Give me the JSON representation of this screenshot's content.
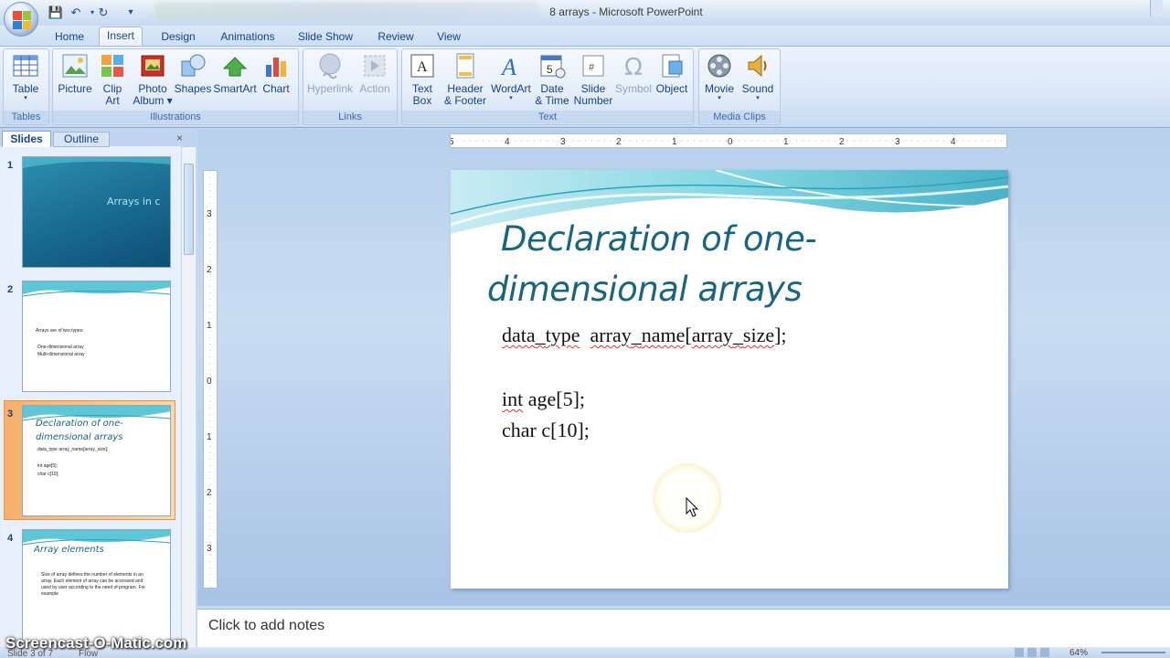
{
  "window": {
    "title": "8 arrays - Microsoft PowerPoint"
  },
  "quick_access": {
    "save_icon": "save-icon",
    "undo_icon": "undo-icon",
    "redo_icon": "redo-icon"
  },
  "tabs": [
    {
      "label": "Home"
    },
    {
      "label": "Insert",
      "active": true
    },
    {
      "label": "Design"
    },
    {
      "label": "Animations"
    },
    {
      "label": "Slide Show"
    },
    {
      "label": "Review"
    },
    {
      "label": "View"
    }
  ],
  "ribbon": {
    "groups": {
      "tables": "Tables",
      "illustrations": "Illustrations",
      "links": "Links",
      "text": "Text",
      "media": "Media Clips"
    },
    "buttons": {
      "table": [
        "Table",
        "▾"
      ],
      "picture": [
        "Picture",
        ""
      ],
      "clip_art": [
        "Clip",
        "Art"
      ],
      "photo_album": [
        "Photo",
        "Album ▾"
      ],
      "shapes": [
        "Shapes",
        ""
      ],
      "smartart": [
        "SmartArt",
        ""
      ],
      "chart": [
        "Chart",
        ""
      ],
      "hyperlink": [
        "Hyperlink",
        ""
      ],
      "action": [
        "Action",
        ""
      ],
      "text_box": [
        "Text",
        "Box"
      ],
      "header_footer": [
        "Header",
        "& Footer"
      ],
      "wordart": [
        "WordArt",
        "▾"
      ],
      "date_time": [
        "Date",
        "& Time"
      ],
      "slide_number": [
        "Slide",
        "Number"
      ],
      "symbol": [
        "Symbol",
        ""
      ],
      "object": [
        "Object",
        ""
      ],
      "movie": [
        "Movie",
        "▾"
      ],
      "sound": [
        "Sound",
        "▾"
      ]
    }
  },
  "slides_pane": {
    "tab_slides": "Slides",
    "tab_outline": "Outline",
    "close": "×",
    "thumbs": [
      {
        "num": "1",
        "title": "Arrays in c"
      },
      {
        "num": "2",
        "lines": [
          "Arrays are of two types:",
          "One-dimensional array",
          "Multi-dimensional array"
        ]
      },
      {
        "num": "3",
        "title": "Declaration of one-dimensional arrays",
        "lines": [
          "data_type  array_name[array_size];",
          "int age[5];",
          "char c[10];"
        ]
      },
      {
        "num": "4",
        "title": "Array elements",
        "lines": [
          "Size of array defines the number of elements in an",
          "array. Each element of array can be accessed and",
          "used by user according to the need of program.  For",
          "example"
        ]
      }
    ],
    "selected_index": 3
  },
  "ruler": {
    "h_labels": [
      "5",
      "4",
      "3",
      "2",
      "1",
      "0",
      "1",
      "2",
      "3",
      "4",
      "5"
    ],
    "v_labels": [
      "3",
      "2",
      "1",
      "0",
      "1",
      "2",
      "3"
    ]
  },
  "slide": {
    "title_line1": "Declaration of one-",
    "title_line2": "dimensional arrays",
    "code": {
      "line1_parts": [
        "data",
        "_",
        "type",
        "  ",
        "array",
        "_",
        "name",
        "[",
        "array",
        "_",
        "size",
        "];"
      ],
      "line2_parts": [
        "int",
        " age[5];"
      ],
      "line3": "char c[10];"
    },
    "colors": {
      "title": "#17657e",
      "wave1": "#5fc6d6",
      "wave2": "#2aa3bd"
    }
  },
  "notes": {
    "placeholder": "Click to add notes"
  },
  "status": {
    "slide": "Slide 3 of 7",
    "theme": "Flow",
    "zoom": "64%"
  },
  "watermark": "Screencast-O-Matic.com"
}
